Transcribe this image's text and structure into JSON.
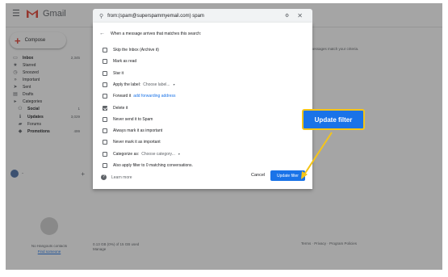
{
  "app": {
    "brand": "Gmail",
    "compose_label": "Compose"
  },
  "sidebar": {
    "items": [
      {
        "label": "Inbox",
        "count": "2,345",
        "icon": "inbox-icon",
        "glyph": "▭",
        "bold": true
      },
      {
        "label": "Starred",
        "count": "",
        "icon": "star-icon",
        "glyph": "★",
        "bold": false
      },
      {
        "label": "Snoozed",
        "count": "",
        "icon": "clock-icon",
        "glyph": "◷",
        "bold": false
      },
      {
        "label": "Important",
        "count": "",
        "icon": "important-icon",
        "glyph": "»",
        "bold": false
      },
      {
        "label": "Sent",
        "count": "",
        "icon": "send-icon",
        "glyph": "➤",
        "bold": false
      },
      {
        "label": "Drafts",
        "count": "",
        "icon": "draft-icon",
        "glyph": "▤",
        "bold": false
      },
      {
        "label": "Categories",
        "count": "",
        "icon": "label-icon",
        "glyph": "▸",
        "bold": false
      },
      {
        "label": "Social",
        "count": "1",
        "icon": "people-icon",
        "glyph": "⚇",
        "bold": true
      },
      {
        "label": "Updates",
        "count": "3,029",
        "icon": "info-icon",
        "glyph": "ℹ",
        "bold": true
      },
      {
        "label": "Forums",
        "count": "",
        "icon": "forum-icon",
        "glyph": "▰",
        "bold": false
      },
      {
        "label": "Promotions",
        "count": "499",
        "icon": "tag-icon",
        "glyph": "◆",
        "bold": true
      }
    ],
    "hangouts_name": "-",
    "hangouts_add": "+",
    "no_contacts": "No Hangouts contacts",
    "find_someone": "Find someone"
  },
  "search": {
    "query": "from:(spam@superspammyemail.com) spam",
    "tune_glyph": "⚙",
    "close_glyph": "✕"
  },
  "filter_panel": {
    "heading": "When a message arrives that matches this search:",
    "options": [
      {
        "label": "Skip the Inbox (Archive it)",
        "checked": false
      },
      {
        "label": "Mark as read",
        "checked": false
      },
      {
        "label": "Star it",
        "checked": false
      },
      {
        "label": "Apply the label:",
        "checked": false,
        "extra": "Choose label...",
        "caret": "▾"
      },
      {
        "label": "Forward it",
        "checked": false,
        "link": "add forwarding address"
      },
      {
        "label": "Delete it",
        "checked": true
      },
      {
        "label": "Never send it to Spam",
        "checked": false
      },
      {
        "label": "Always mark it as important",
        "checked": false
      },
      {
        "label": "Never mark it as important",
        "checked": false
      },
      {
        "label": "Categorize as:",
        "checked": false,
        "extra": "Choose category...",
        "caret": "▾"
      },
      {
        "label": "Also apply filter to 0 matching conversations.",
        "checked": false
      }
    ],
    "learn_more": "Learn more",
    "cancel": "Cancel",
    "update": "Update filter"
  },
  "background": {
    "right_hint": "ing messages match your criteria.",
    "storage_line1": "0.13 GB (0%) of 15 GB used",
    "storage_line2": "Manage",
    "footer": "Terms · Privacy · Program Policies"
  },
  "callout": {
    "label": "Update filter"
  },
  "colors": {
    "accent_blue": "#1a73e8",
    "callout_border": "#f5c518",
    "gmail_red": "#e44133"
  }
}
